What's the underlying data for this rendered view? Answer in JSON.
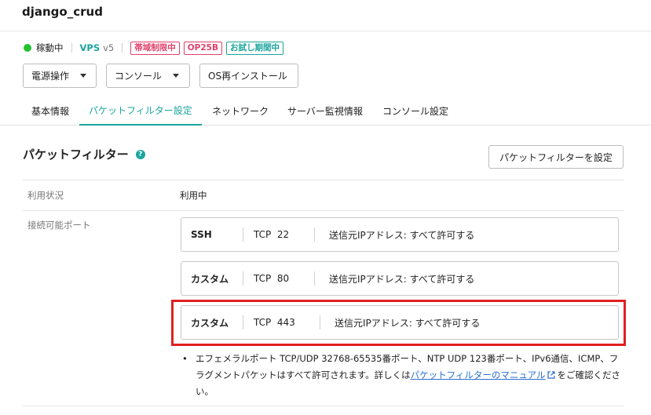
{
  "server": {
    "name": "django_crud"
  },
  "status": {
    "state": "稼動中",
    "service": "VPS",
    "version": "v5",
    "badges": [
      "帯域制限中",
      "OP25B",
      "お試し期間中"
    ],
    "colors": {
      "running": "#22c32e",
      "accent": "#1aa59e",
      "badge_warning": "#e0406a",
      "highlight": "#e02020",
      "link": "#2a6fcf"
    }
  },
  "actions": {
    "power": "電源操作",
    "console": "コンソール",
    "reinstall": "OS再インストール"
  },
  "tabs": [
    {
      "label": "基本情報",
      "active": false
    },
    {
      "label": "パケットフィルター設定",
      "active": true
    },
    {
      "label": "ネットワーク",
      "active": false
    },
    {
      "label": "サーバー監視情報",
      "active": false
    },
    {
      "label": "コンソール設定",
      "active": false
    }
  ],
  "packet_filter": {
    "title": "パケットフィルター",
    "help_icon": "?",
    "set_button": "パケットフィルターを設定",
    "usage_label": "利用状況",
    "usage_value": "利用中",
    "ports_label": "接続可能ポート",
    "ports": [
      {
        "type": "SSH",
        "protocol": "TCP",
        "port": "22",
        "source": "送信元IPアドレス: すべて許可する"
      },
      {
        "type": "カスタム",
        "protocol": "TCP",
        "port": "80",
        "source": "送信元IPアドレス: すべて許可する"
      },
      {
        "type": "カスタム",
        "protocol": "TCP",
        "port": "443",
        "source": "送信元IPアドレス: すべて許可する"
      }
    ],
    "note": {
      "text_before": "エフェメラルポート TCP/UDP 32768-65535番ポート、NTP UDP 123番ポート、IPv6通信、ICMP、フラグメントパケットはすべて許可されます。詳しくは",
      "link_text": "パケットフィルターのマニュアル",
      "text_after": "をご確認ください。"
    }
  }
}
